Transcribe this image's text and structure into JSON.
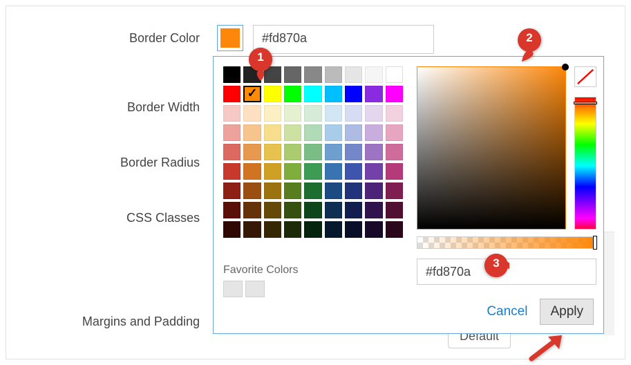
{
  "labels": {
    "border_color": "Border Color",
    "border_width": "Border Width",
    "border_radius": "Border Radius",
    "css_classes": "CSS Classes",
    "margins_padding": "Margins and Padding"
  },
  "current_color": "#fd870a",
  "hex_display": "#fd870a",
  "default_label": "Default",
  "picker": {
    "favorite_label": "Favorite Colors",
    "hex_value": "#fd870a",
    "cancel_label": "Cancel",
    "apply_label": "Apply",
    "accent": "#fd870a",
    "palette": [
      [
        "#000000",
        "#222222",
        "#444444",
        "#666666",
        "#888888",
        "#bbbbbb",
        "#e5e5e5",
        "#f5f5f5",
        "#ffffff"
      ],
      [
        "#ff0000",
        "#ff8c00",
        "#ffff00",
        "#00ff00",
        "#00ffff",
        "#00bfff",
        "#0000ff",
        "#8a2be2",
        "#ff00ff"
      ],
      [
        "#f6c9c5",
        "#fde0c2",
        "#fcefc3",
        "#e4f0cf",
        "#d7ecd8",
        "#d3e6f3",
        "#d6ddf2",
        "#e3d6ee",
        "#f2d1df"
      ],
      [
        "#eda29b",
        "#f7c48d",
        "#f7de8d",
        "#cde1a3",
        "#b1dab6",
        "#a9cde8",
        "#adbbe5",
        "#c8aede",
        "#e6a6c1"
      ],
      [
        "#dd6a60",
        "#e79a4f",
        "#e8c24e",
        "#aacb6e",
        "#7bbd86",
        "#6e9fce",
        "#7387c9",
        "#9d73c4",
        "#cf6c9c"
      ],
      [
        "#c7392c",
        "#d07424",
        "#cfa024",
        "#7fae3c",
        "#3e9b54",
        "#3873b2",
        "#3f55ad",
        "#7341aa",
        "#b43a79"
      ],
      [
        "#8d1f15",
        "#9a4f10",
        "#9a7310",
        "#577d1f",
        "#1d6d30",
        "#1b4b80",
        "#22327b",
        "#4d2279",
        "#7f1e50"
      ],
      [
        "#5a0f08",
        "#653108",
        "#654908",
        "#365010",
        "#0e451b",
        "#0e2f52",
        "#121e4e",
        "#30124d",
        "#511032"
      ],
      [
        "#2f0703",
        "#351904",
        "#352604",
        "#1c2a08",
        "#06240d",
        "#06182b",
        "#090f29",
        "#190928",
        "#2a071a"
      ]
    ],
    "selected": [
      1,
      1
    ]
  },
  "annotations": {
    "pin1": "1",
    "pin2": "2",
    "pin3": "3"
  }
}
